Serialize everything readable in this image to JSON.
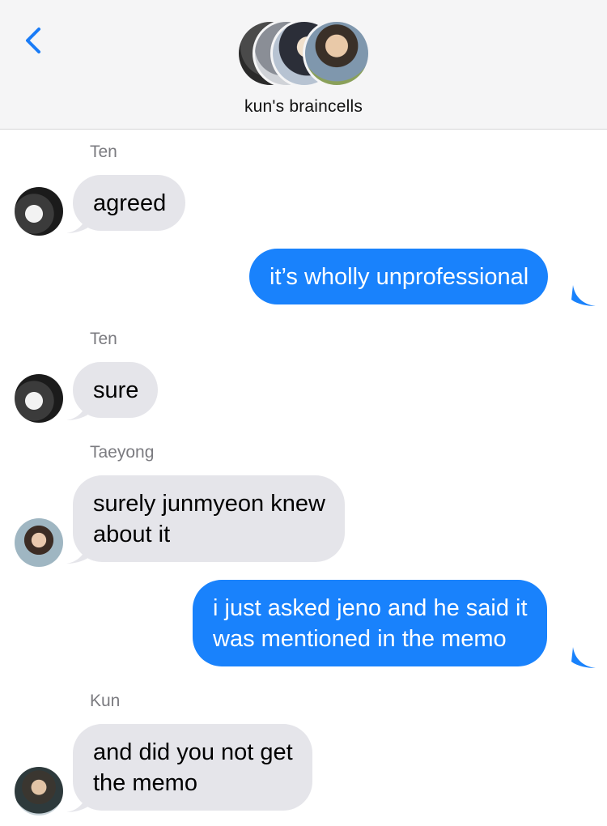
{
  "header": {
    "back_icon": "chevron-left-icon",
    "group_avatars": [
      "avatar-1",
      "avatar-2",
      "avatar-3",
      "avatar-4"
    ],
    "title": "kun's braincells"
  },
  "colors": {
    "sent_bubble": "#1982fc",
    "received_bubble": "#e5e5ea",
    "back_arrow": "#1a7cf7",
    "sender_name": "#7b7b80"
  },
  "messages": [
    {
      "sender": "Ten",
      "text": "agreed",
      "direction": "received"
    },
    {
      "text": "it’s wholly unprofessional",
      "direction": "sent"
    },
    {
      "sender": "Ten",
      "text": "sure",
      "direction": "received"
    },
    {
      "sender": "Taeyong",
      "lines": [
        "surely junmyeon knew",
        "about it"
      ],
      "direction": "received"
    },
    {
      "lines": [
        "i just asked jeno and he said it",
        "was mentioned in the memo"
      ],
      "direction": "sent"
    },
    {
      "sender": "Kun",
      "lines": [
        "and did you not get",
        "the memo"
      ],
      "direction": "received"
    }
  ]
}
